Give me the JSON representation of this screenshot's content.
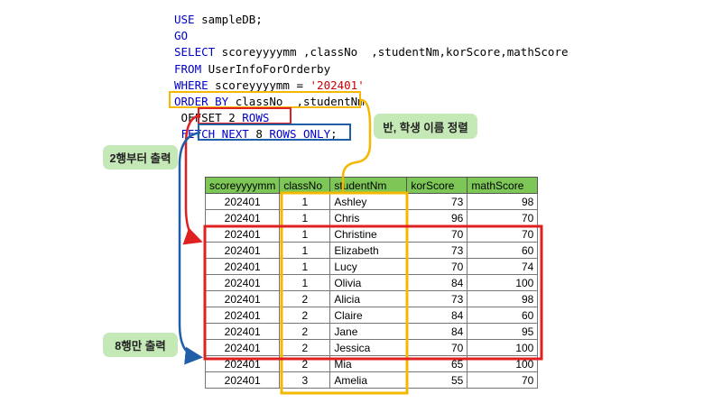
{
  "code_lines": [
    [
      {
        "t": "USE",
        "c": "kw"
      },
      {
        "t": " sampleDB;",
        "c": "plain"
      }
    ],
    [
      {
        "t": "GO",
        "c": "kw"
      }
    ],
    [
      {
        "t": "SELECT",
        "c": "kw"
      },
      {
        "t": " scoreyyyymm ,classNo  ,studentNm,korScore,mathScore",
        "c": "plain"
      }
    ],
    [
      {
        "t": "FROM",
        "c": "kw"
      },
      {
        "t": " UserInfoForOrderby",
        "c": "plain"
      }
    ],
    [
      {
        "t": "WHERE",
        "c": "kw"
      },
      {
        "t": " scoreyyyymm = ",
        "c": "plain"
      },
      {
        "t": "'202401'",
        "c": "str"
      }
    ],
    [
      {
        "t": "ORDER BY",
        "c": "kw"
      },
      {
        "t": " classNo  ,studentNm",
        "c": "plain"
      }
    ],
    [
      {
        "t": " OFFSET 2 ",
        "c": "plain"
      },
      {
        "t": "ROWS",
        "c": "kw"
      }
    ],
    [
      {
        "t": " FETCH NEXT",
        "c": "kw"
      },
      {
        "t": " 8 ",
        "c": "plain"
      },
      {
        "t": "ROWS ONLY",
        "c": "kw"
      },
      {
        "t": ";",
        "c": "plain"
      }
    ]
  ],
  "callouts": {
    "sort_label": "반, 학생 이름 정렬",
    "offset_label": "2행부터 출력",
    "fetch_label": "8행만 출력"
  },
  "table": {
    "headers": [
      "scoreyyyymm",
      "classNo",
      "studentNm",
      "korScore",
      "mathScore"
    ],
    "rows": [
      [
        "202401",
        "1",
        "Ashley",
        "73",
        "98"
      ],
      [
        "202401",
        "1",
        "Chris",
        "96",
        "70"
      ],
      [
        "202401",
        "1",
        "Christine",
        "70",
        "70"
      ],
      [
        "202401",
        "1",
        "Elizabeth",
        "73",
        "60"
      ],
      [
        "202401",
        "1",
        "Lucy",
        "70",
        "74"
      ],
      [
        "202401",
        "1",
        "Olivia",
        "84",
        "100"
      ],
      [
        "202401",
        "2",
        "Alicia",
        "73",
        "98"
      ],
      [
        "202401",
        "2",
        "Claire",
        "84",
        "60"
      ],
      [
        "202401",
        "2",
        "Jane",
        "84",
        "95"
      ],
      [
        "202401",
        "2",
        "Jessica",
        "70",
        "100"
      ],
      [
        "202401",
        "2",
        "Mia",
        "65",
        "100"
      ],
      [
        "202401",
        "3",
        "Amelia",
        "55",
        "70"
      ]
    ]
  },
  "colors": {
    "keyword": "#0000cc",
    "string": "#cc0000",
    "header_fill": "#7dc757",
    "callout_fill": "#c5e8b7",
    "order_box": "#f5b800",
    "offset_box": "#e02020",
    "fetch_box": "#1f5fa8"
  }
}
